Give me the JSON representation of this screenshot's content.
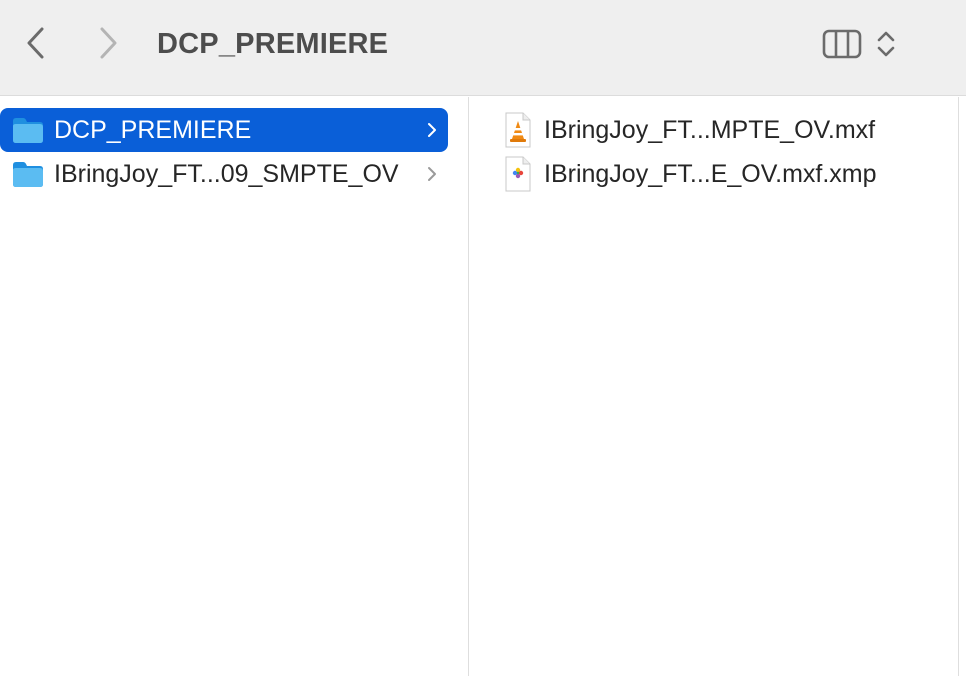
{
  "toolbar": {
    "title": "DCP_PREMIERE",
    "back_icon": "chevron-left-icon",
    "forward_icon": "chevron-right-icon",
    "view_icon": "column-view-icon",
    "sort_icon": "up-down-chevron-icon"
  },
  "column1": {
    "items": [
      {
        "label": "DCP_PREMIERE",
        "icon": "folder-icon",
        "selected": true
      },
      {
        "label": "IBringJoy_FT...09_SMPTE_OV",
        "icon": "folder-icon",
        "selected": false
      }
    ]
  },
  "column2": {
    "items": [
      {
        "label": "IBringJoy_FT...MPTE_OV.mxf",
        "icon": "vlc-document-icon"
      },
      {
        "label": "IBringJoy_FT...E_OV.mxf.xmp",
        "icon": "xmp-document-icon"
      }
    ]
  },
  "colors": {
    "selection": "#0a5fd8",
    "toolbar_bg": "#efefef",
    "folder_blue": "#3aa9ec"
  }
}
